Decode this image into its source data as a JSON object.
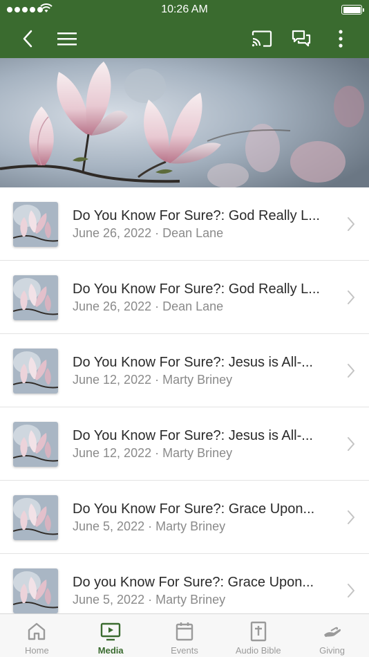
{
  "colors": {
    "brand": "#3a6b2f",
    "inactive": "#9a9a9a"
  },
  "status_bar": {
    "time": "10:26 AM"
  },
  "nav": {
    "back_icon": "chevron-left-icon",
    "menu_icon": "hamburger-menu-icon",
    "cast_icon": "cast-icon",
    "chat_icon": "chat-bubbles-icon",
    "more_icon": "more-vertical-icon"
  },
  "media_items": [
    {
      "title": "Do You Know For Sure?: God Really L...",
      "meta": "June 26, 2022 · Dean Lane"
    },
    {
      "title": "Do You Know For Sure?: God Really L...",
      "meta": "June 26, 2022 · Dean Lane"
    },
    {
      "title": "Do You Know For Sure?: Jesus is All-...",
      "meta": "June 12, 2022 · Marty Briney"
    },
    {
      "title": "Do You Know For Sure?: Jesus is All-...",
      "meta": "June 12, 2022 · Marty Briney"
    },
    {
      "title": "Do You Know For Sure?: Grace Upon...",
      "meta": "June 5, 2022 · Marty Briney"
    },
    {
      "title": "Do you Know For Sure?: Grace Upon...",
      "meta": "June 5, 2022 · Marty Briney"
    }
  ],
  "tabs": [
    {
      "label": "Home",
      "icon": "home-icon",
      "active": false
    },
    {
      "label": "Media",
      "icon": "tv-icon",
      "active": true
    },
    {
      "label": "Events",
      "icon": "calendar-icon",
      "active": false
    },
    {
      "label": "Audio Bible",
      "icon": "bible-icon",
      "active": false
    },
    {
      "label": "Giving",
      "icon": "giving-hand-icon",
      "active": false
    }
  ]
}
